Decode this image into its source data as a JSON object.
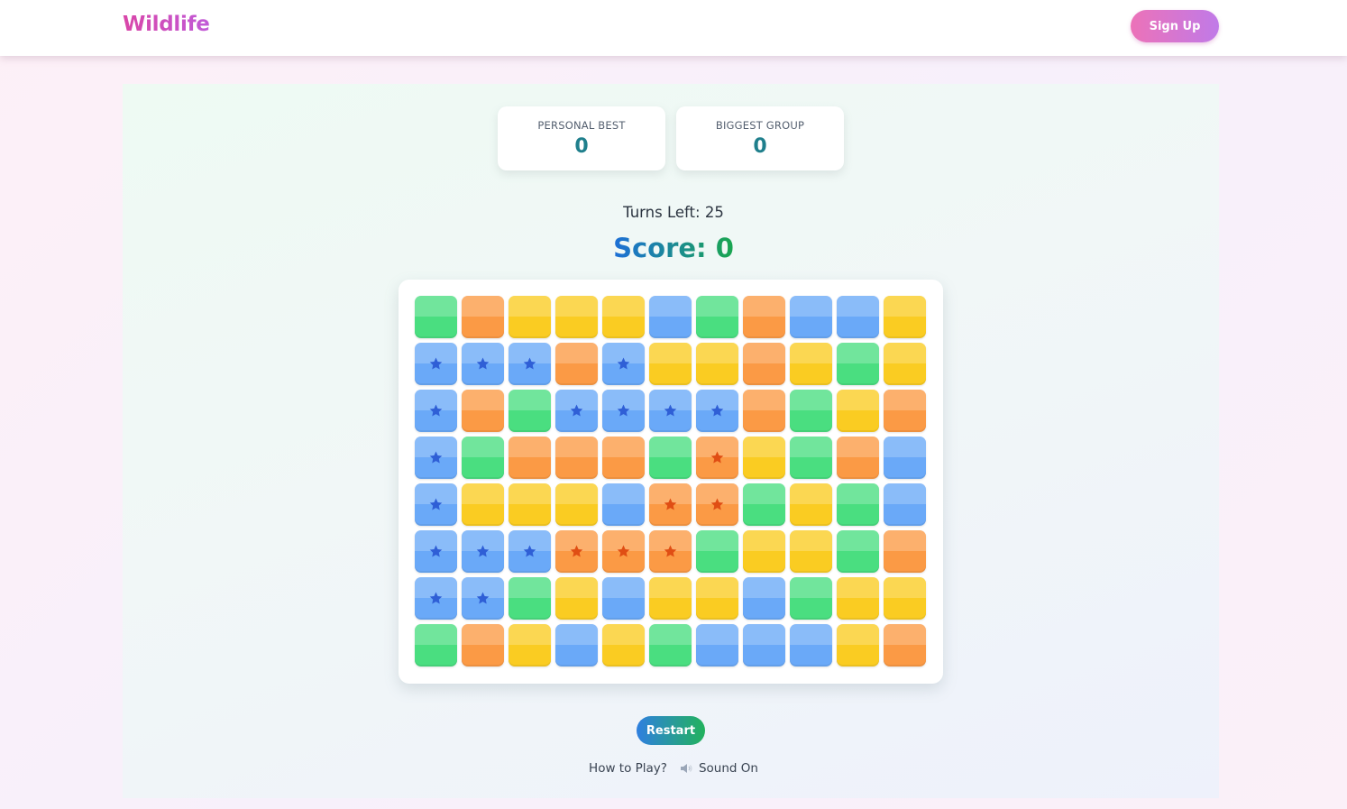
{
  "header": {
    "logo": "Wildlife",
    "signup_label": "Sign Up"
  },
  "stats": {
    "personal_best_label": "PERSONAL BEST",
    "personal_best_value": "0",
    "biggest_group_label": "BIGGEST GROUP",
    "biggest_group_value": "0"
  },
  "game": {
    "turns_left": "Turns Left: 25",
    "score": "Score: 0",
    "board": [
      [
        "green",
        "orange",
        "yellow",
        "yellow",
        "yellow",
        "blue",
        "green",
        "orange",
        "blue",
        "blue",
        "yellow"
      ],
      [
        "blue*",
        "blue*",
        "blue*",
        "orange",
        "blue*",
        "yellow",
        "yellow",
        "orange",
        "yellow",
        "green",
        "yellow"
      ],
      [
        "blue*",
        "orange",
        "green",
        "blue*",
        "blue*",
        "blue*",
        "blue*",
        "orange",
        "green",
        "yellow",
        "orange"
      ],
      [
        "blue*",
        "green",
        "orange",
        "orange",
        "orange",
        "green",
        "orange*",
        "yellow",
        "green",
        "orange",
        "blue"
      ],
      [
        "blue*",
        "yellow",
        "yellow",
        "yellow",
        "blue",
        "orange*",
        "orange*",
        "green",
        "yellow",
        "green",
        "blue"
      ],
      [
        "blue*",
        "blue*",
        "blue*",
        "orange*",
        "orange*",
        "orange*",
        "green",
        "yellow",
        "yellow",
        "green",
        "orange"
      ],
      [
        "blue*",
        "blue*",
        "green",
        "yellow",
        "blue",
        "yellow",
        "yellow",
        "blue",
        "green",
        "yellow",
        "yellow"
      ],
      [
        "green",
        "orange",
        "yellow",
        "blue",
        "yellow",
        "green",
        "blue",
        "blue",
        "blue",
        "yellow",
        "orange"
      ]
    ]
  },
  "controls": {
    "restart_label": "Restart",
    "how_to_play": "How to Play?",
    "sound_label": "Sound On",
    "sound_icon": "speaker-icon"
  }
}
